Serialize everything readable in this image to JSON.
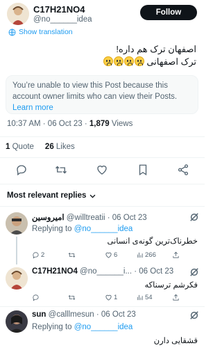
{
  "header": {
    "display_name": "C17H21NO4",
    "handle": "@no______idea",
    "follow_label": "Follow"
  },
  "translate_label": "Show translation",
  "tweet": {
    "line1": "اصفهان ترک هم داره!",
    "line2": "ترک اصفهانی",
    "emoji": "fearful-face"
  },
  "notice": {
    "text": "You’re unable to view this Post because this account owner limits who can view their Posts.",
    "link": "Learn more"
  },
  "meta": {
    "time": "10:37 AM · 06 Oct 23 · ",
    "views_count": "1,879",
    "views_label": " Views"
  },
  "stats": {
    "quotes_count": "1",
    "quotes_label": " Quote",
    "likes_count": "26",
    "likes_label": " Likes"
  },
  "replies_sort": "Most relevant replies",
  "replies": [
    {
      "name": "امیروسین",
      "handle": "@willtreatii",
      "date": "· 06 Oct 23",
      "replying_prefix": "Replying to ",
      "replying_to": "@no______idea",
      "text": "خطرناک‌ترین گونه‌ی انسانی",
      "reply_count": "2",
      "retweet_count": "",
      "like_count": "6",
      "view_count": "266"
    },
    {
      "name": "C17H21NO4",
      "handle": "@no______i...",
      "date": "· 06 Oct 23",
      "text": "فکرشم ترسناکه",
      "reply_count": "",
      "retweet_count": "",
      "like_count": "1",
      "view_count": "54"
    },
    {
      "name": "sun",
      "handle": "@calllmesun",
      "date": "· 06 Oct 23",
      "replying_prefix": "Replying to ",
      "replying_to": "@no______idea",
      "text": "قشقایی دارن"
    }
  ],
  "colors": {
    "accent": "#1d9bf0",
    "text": "#0f1419",
    "muted": "#536471",
    "divider": "#eff3f4"
  }
}
